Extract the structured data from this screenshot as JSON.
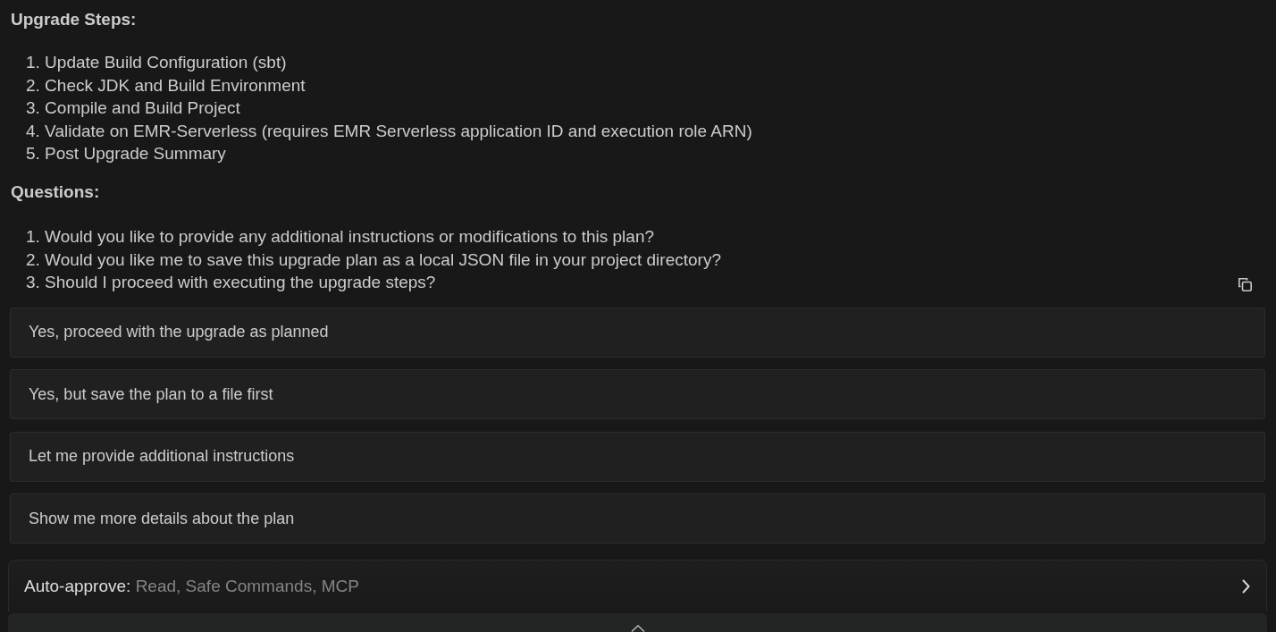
{
  "sections": [
    {
      "heading": "Upgrade Steps:",
      "items": [
        "1. Update Build Configuration (sbt)",
        "2. Check JDK and Build Environment",
        "3. Compile and Build Project",
        "4. Validate on EMR-Serverless (requires EMR Serverless application ID and execution role ARN)",
        "5. Post Upgrade Summary"
      ]
    },
    {
      "heading": "Questions:",
      "items": [
        "1. Would you like to provide any additional instructions or modifications to this plan?",
        "2. Would you like me to save this upgrade plan as a local JSON file in your project directory?",
        "3. Should I proceed with executing the upgrade steps?"
      ]
    }
  ],
  "options": [
    "Yes, proceed with the upgrade as planned",
    "Yes, but save the plan to a file first",
    "Let me provide additional instructions",
    "Show me more details about the plan"
  ],
  "auto_approve": {
    "label": "Auto-approve:",
    "value": "Read, Safe Commands, MCP"
  }
}
